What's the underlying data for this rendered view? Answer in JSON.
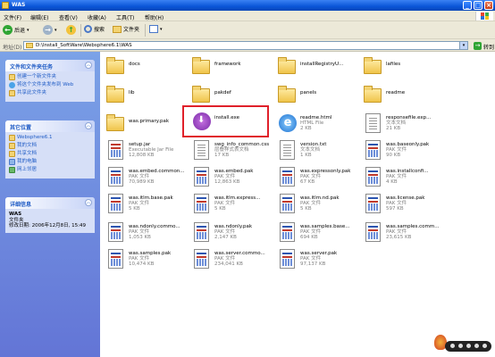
{
  "window": {
    "title": "WAS"
  },
  "menu": [
    "文件(F)",
    "编辑(E)",
    "查看(V)",
    "收藏(A)",
    "工具(T)",
    "帮助(H)"
  ],
  "toolbar": {
    "back": "后退",
    "search": "搜索",
    "folders": "文件夹"
  },
  "address": {
    "label": "地址(D)",
    "path": "D:\\Install_SoftWare\\Websphere6.1\\WAS",
    "go": "转到"
  },
  "tasks_panel": {
    "title": "文件和文件夹任务",
    "items": [
      "创建一个新文件夹",
      "将这个文件夹发布到 Web",
      "共享此文件夹"
    ]
  },
  "places_panel": {
    "title": "其它位置",
    "items": [
      "Websphere6.1",
      "我的文档",
      "共享文档",
      "我的电脑",
      "网上邻居"
    ]
  },
  "details_panel": {
    "title": "详细信息",
    "name": "WAS",
    "type": "文件夹",
    "modified": "修改日期: 2006年12月8日, 15:49"
  },
  "files": [
    {
      "name": "docs",
      "kind": "folder"
    },
    {
      "name": "framework",
      "kind": "folder"
    },
    {
      "name": "installRegistryU...",
      "kind": "folder"
    },
    {
      "name": "lafiles",
      "kind": "folder"
    },
    {
      "name": "lib",
      "kind": "folder"
    },
    {
      "name": "pakdef",
      "kind": "folder"
    },
    {
      "name": "panels",
      "kind": "folder"
    },
    {
      "name": "readme",
      "kind": "folder"
    },
    {
      "name": "was.primary.pak",
      "kind": "folder"
    },
    {
      "name": "install.exe",
      "kind": "exe"
    },
    {
      "name": "readme.html",
      "kind": "html",
      "type": "HTML File",
      "size": "2 KB"
    },
    {
      "name": "responsefile.exp...",
      "kind": "txt",
      "type": "文本文档",
      "size": "21 KB"
    },
    {
      "name": "setup.jar",
      "kind": "jar",
      "type": "Executable Jar File",
      "size": "12,808 KB"
    },
    {
      "name": "swg_info_common.css",
      "kind": "css",
      "type": "层叠样式表文档",
      "size": "17 KB"
    },
    {
      "name": "version.txt",
      "kind": "txt",
      "type": "文本文档",
      "size": "1 KB"
    },
    {
      "name": "was.baseonly.pak",
      "kind": "pak",
      "type": "PAK 文件",
      "size": "90 KB"
    },
    {
      "name": "was.embed.common...",
      "kind": "pak",
      "type": "PAK 文件",
      "size": "70,989 KB"
    },
    {
      "name": "was.embed.pak",
      "kind": "pak",
      "type": "PAK 文件",
      "size": "12,863 KB"
    },
    {
      "name": "was.expressonly.pak",
      "kind": "pak",
      "type": "PAK 文件",
      "size": "67 KB"
    },
    {
      "name": "was.installconfi...",
      "kind": "pak",
      "type": "PAK 文件",
      "size": "4 KB"
    },
    {
      "name": "was.itlm.base.pak",
      "kind": "pak",
      "type": "PAK 文件",
      "size": "5 KB"
    },
    {
      "name": "was.itlm.express...",
      "kind": "pak",
      "type": "PAK 文件",
      "size": "5 KB"
    },
    {
      "name": "was.itlm.nd.pak",
      "kind": "pak",
      "type": "PAK 文件",
      "size": "5 KB"
    },
    {
      "name": "was.license.pak",
      "kind": "pak",
      "type": "PAK 文件",
      "size": "597 KB"
    },
    {
      "name": "was.ndonly.commo...",
      "kind": "pak",
      "type": "PAK 文件",
      "size": "1,053 KB"
    },
    {
      "name": "was.ndonly.pak",
      "kind": "pak",
      "type": "PAK 文件",
      "size": "2,147 KB"
    },
    {
      "name": "was.samples.base...",
      "kind": "pak",
      "type": "PAK 文件",
      "size": "694 KB"
    },
    {
      "name": "was.samples.comm...",
      "kind": "pak",
      "type": "PAK 文件",
      "size": "23,615 KB"
    },
    {
      "name": "was.samples.pak",
      "kind": "pak",
      "type": "PAK 文件",
      "size": "10,474 KB"
    },
    {
      "name": "was.server.commo...",
      "kind": "pak",
      "type": "PAK 文件",
      "size": "234,041 KB"
    },
    {
      "name": "was.server.pak",
      "kind": "pak",
      "type": "PAK 文件",
      "size": "97,137 KB"
    }
  ]
}
